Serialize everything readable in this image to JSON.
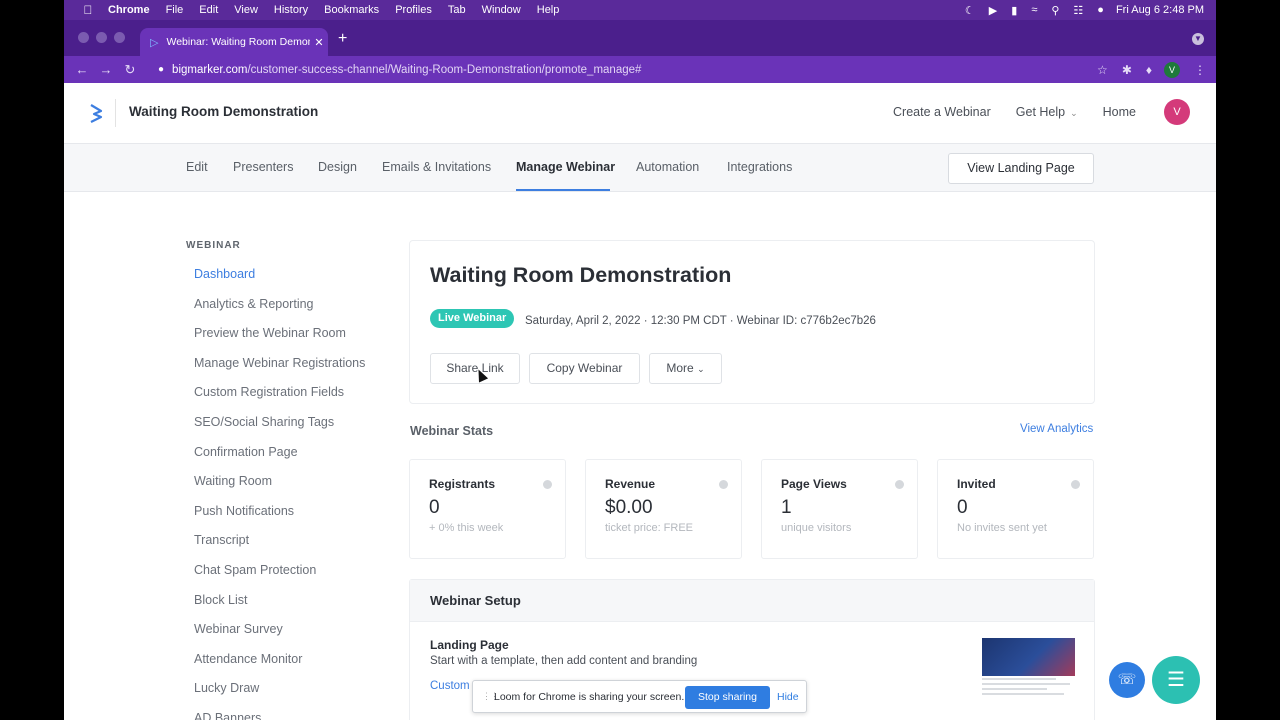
{
  "menubar": {
    "app": "Chrome",
    "items": [
      "File",
      "Edit",
      "View",
      "History",
      "Bookmarks",
      "Profiles",
      "Tab",
      "Window",
      "Help"
    ],
    "clock": "Fri Aug 6  2:48 PM"
  },
  "browser": {
    "tab_title": "Webinar: Waiting Room Demonstr",
    "url_host": "bigmarker.com",
    "url_path": "/customer-success-channel/Waiting-Room-Demonstration/promote_manage#",
    "profile_initial": "V"
  },
  "header": {
    "title": "Waiting Room Demonstration",
    "links": [
      "Create a Webinar",
      "Get Help",
      "Home"
    ],
    "avatar_initial": "V"
  },
  "subnav": {
    "items": [
      "Edit",
      "Presenters",
      "Design",
      "Emails & Invitations",
      "Manage Webinar",
      "Automation",
      "Integrations"
    ],
    "active": "Manage Webinar",
    "view_landing": "View Landing Page"
  },
  "sidebar": {
    "heading": "WEBINAR",
    "items": [
      "Dashboard",
      "Analytics & Reporting",
      "Preview the Webinar Room",
      "Manage Webinar Registrations",
      "Custom Registration Fields",
      "SEO/Social Sharing Tags",
      "Confirmation Page",
      "Waiting Room",
      "Push Notifications",
      "Transcript",
      "Chat Spam Protection",
      "Block List",
      "Webinar Survey",
      "Attendance Monitor",
      "Lucky Draw",
      "AD Banners"
    ],
    "active": "Dashboard"
  },
  "webinar": {
    "title": "Waiting Room Demonstration",
    "badge": "Live Webinar",
    "meta": "Saturday, April 2, 2022 · 12:30 PM CDT · Webinar ID: c776b2ec7b26",
    "buttons": [
      "Share Link",
      "Copy Webinar",
      "More"
    ]
  },
  "stats": {
    "title": "Webinar Stats",
    "view_analytics": "View Analytics",
    "cards": [
      {
        "label": "Registrants",
        "value": "0",
        "sub": "+ 0% this week"
      },
      {
        "label": "Revenue",
        "value": "$0.00",
        "sub": "ticket price: FREE"
      },
      {
        "label": "Page Views",
        "value": "1",
        "sub": "unique visitors"
      },
      {
        "label": "Invited",
        "value": "0",
        "sub": "No invites sent yet"
      }
    ]
  },
  "setup": {
    "title": "Webinar Setup",
    "landing_title": "Landing Page",
    "landing_desc": "Start with a template, then add content and branding",
    "customize_link": "Custom"
  },
  "loom": {
    "message": "Loom for Chrome is sharing your screen.",
    "stop": "Stop sharing",
    "hide": "Hide"
  },
  "colors": {
    "accent": "#3d7ee0",
    "badge": "#2dc6b4",
    "browser_chrome": "#6a33b8"
  }
}
